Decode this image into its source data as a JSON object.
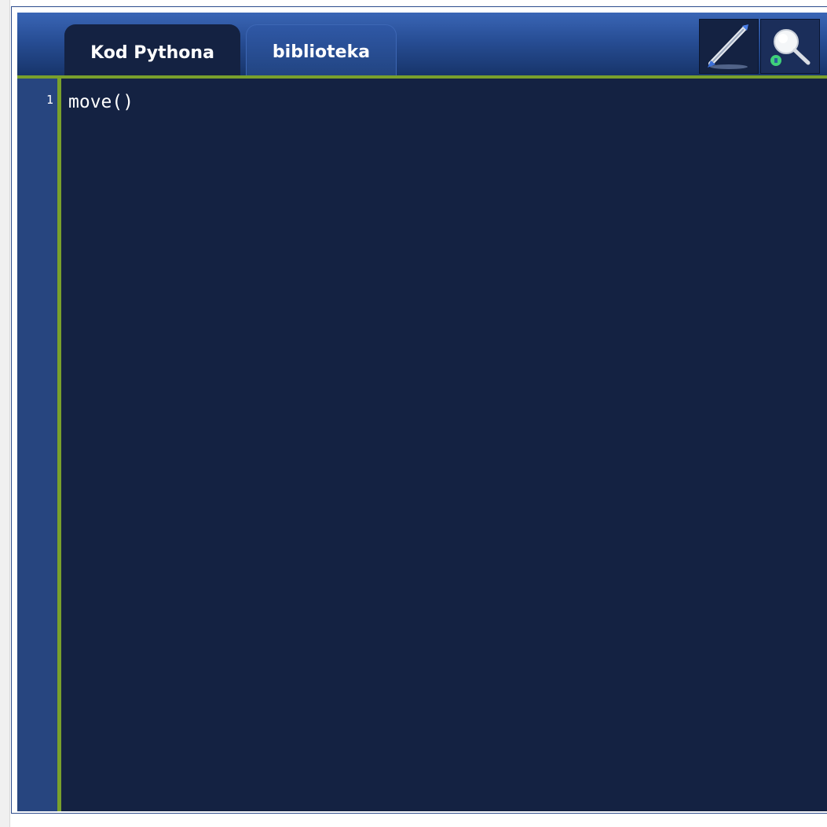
{
  "tabs": [
    {
      "label": "Kod Pythona",
      "active": true
    },
    {
      "label": "biblioteka",
      "active": false
    }
  ],
  "toolbar": {
    "buttons": [
      {
        "icon": "pencil-icon"
      },
      {
        "icon": "magnifier-icon"
      }
    ]
  },
  "editor": {
    "lines": [
      {
        "number": "1",
        "code": "move()"
      }
    ]
  },
  "colors": {
    "toolbar_top": "#3a66b6",
    "toolbar_bottom": "#173469",
    "editor_bg": "#142242",
    "gutter_bg": "#27457f",
    "accent_green": "#79a02c",
    "text": "#ffffff"
  }
}
